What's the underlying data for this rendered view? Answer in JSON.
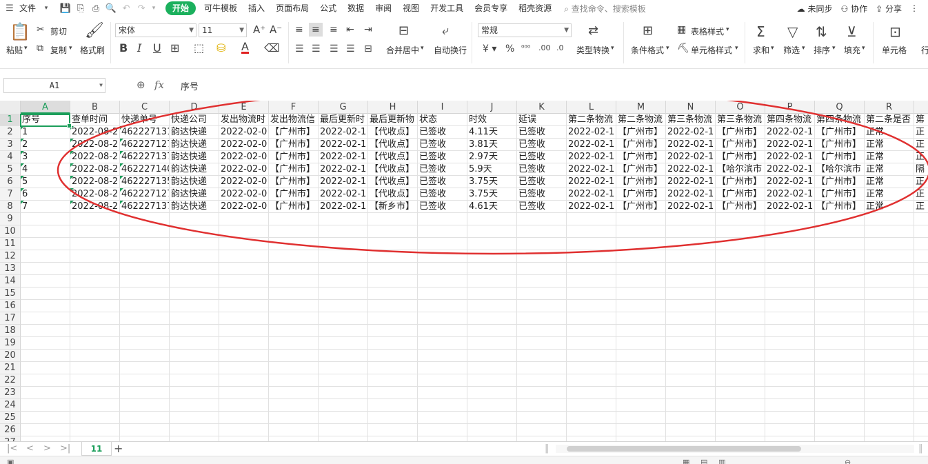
{
  "menubar": {
    "file": "文件",
    "tabs": [
      "开始",
      "可牛模板",
      "插入",
      "页面布局",
      "公式",
      "数据",
      "审阅",
      "视图",
      "开发工具",
      "会员专享",
      "稻壳资源"
    ],
    "active_tab": "开始",
    "search_placeholder": "查找命令、搜索模板",
    "right": [
      "未同步",
      "协作",
      "分享"
    ]
  },
  "ribbon": {
    "paste": "粘贴",
    "cut": "剪切",
    "copy": "复制",
    "format_painter": "格式刷",
    "font_name": "宋体",
    "font_size": "11",
    "merge_center": "合并居中",
    "wrap_text": "自动换行",
    "number_format": "常规",
    "type_convert": "类型转换",
    "cond_format": "条件格式",
    "table_style": "表格样式",
    "cell_style": "单元格样式",
    "sum": "求和",
    "filter": "筛选",
    "sort": "排序",
    "fill": "填充",
    "cell": "单元格",
    "row_col": "行"
  },
  "formula_bar": {
    "cell_ref": "A1",
    "fx": "fx",
    "content": "序号"
  },
  "grid": {
    "selected_cell": "A1",
    "columns": [
      "A",
      "B",
      "C",
      "D",
      "E",
      "F",
      "G",
      "H",
      "I",
      "J",
      "K",
      "L",
      "M",
      "N",
      "O",
      "P",
      "Q",
      "R",
      "S"
    ],
    "row_numbers": [
      "1",
      "2",
      "3",
      "4",
      "5",
      "6",
      "7",
      "8",
      "9",
      "10",
      "11",
      "12",
      "13",
      "14",
      "15",
      "16",
      "17",
      "18",
      "19",
      "20",
      "21",
      "22",
      "23",
      "24",
      "25",
      "26",
      "27"
    ],
    "rows": [
      [
        "序号",
        "查单时间",
        "快递单号",
        "快递公司",
        "发出物流时",
        "发出物流信",
        "最后更新时",
        "最后更新物",
        "状态",
        "时效",
        "延误",
        "第二条物流",
        "第二条物流",
        "第三条物流",
        "第三条物流",
        "第四条物流",
        "第四条物流",
        "第二条是否",
        "第"
      ],
      [
        "1",
        "2022-08-2",
        "462227131",
        "韵达快递",
        "2022-02-0",
        "【广州市】",
        "2022-02-1",
        "【代收点】",
        "已签收",
        "4.11天",
        "已签收",
        "2022-02-1",
        "【广州市】",
        "2022-02-1",
        "【广州市】",
        "2022-02-1",
        "【广州市】",
        "正常",
        "正"
      ],
      [
        "2",
        "2022-08-2",
        "462227127",
        "韵达快递",
        "2022-02-0",
        "【广州市】",
        "2022-02-1",
        "【代收点】",
        "已签收",
        "3.81天",
        "已签收",
        "2022-02-1",
        "【广州市】",
        "2022-02-1",
        "【广州市】",
        "2022-02-1",
        "【广州市】",
        "正常",
        "正"
      ],
      [
        "3",
        "2022-08-2",
        "462227137",
        "韵达快递",
        "2022-02-0",
        "【广州市】",
        "2022-02-1",
        "【代收点】",
        "已签收",
        "2.97天",
        "已签收",
        "2022-02-1",
        "【广州市】",
        "2022-02-1",
        "【广州市】",
        "2022-02-1",
        "【广州市】",
        "正常",
        "正"
      ],
      [
        "4",
        "2022-08-2",
        "462227140",
        "韵达快递",
        "2022-02-0",
        "【广州市】",
        "2022-02-1",
        "【代收点】",
        "已签收",
        "5.9天",
        "已签收",
        "2022-02-1",
        "【广州市】",
        "2022-02-1",
        "【哈尔滨市",
        "2022-02-1",
        "【哈尔滨市",
        "正常",
        "隔"
      ],
      [
        "5",
        "2022-08-2",
        "462227135",
        "韵达快递",
        "2022-02-0",
        "【广州市】",
        "2022-02-1",
        "【代收点】",
        "已签收",
        "3.75天",
        "已签收",
        "2022-02-1",
        "【广州市】",
        "2022-02-1",
        "【广州市】",
        "2022-02-1",
        "【广州市】",
        "正常",
        "正"
      ],
      [
        "6",
        "2022-08-2",
        "462227127",
        "韵达快递",
        "2022-02-0",
        "【广州市】",
        "2022-02-1",
        "【代收点】",
        "已签收",
        "3.75天",
        "已签收",
        "2022-02-1",
        "【广州市】",
        "2022-02-1",
        "【广州市】",
        "2022-02-1",
        "【广州市】",
        "正常",
        "正"
      ],
      [
        "7",
        "2022-08-2",
        "462227137",
        "韵达快递",
        "2022-02-0",
        "【广州市】",
        "2022-02-1",
        "【新乡市】",
        "已签收",
        "4.61天",
        "已签收",
        "2022-02-1",
        "【广州市】",
        "2022-02-1",
        "【广州市】",
        "2022-02-1",
        "【广州市】",
        "正常",
        "正"
      ]
    ]
  },
  "sheet_tabs": {
    "active": "11",
    "add": "+"
  },
  "colors": {
    "accent": "#1bb05d",
    "annotation": "#e03030"
  }
}
